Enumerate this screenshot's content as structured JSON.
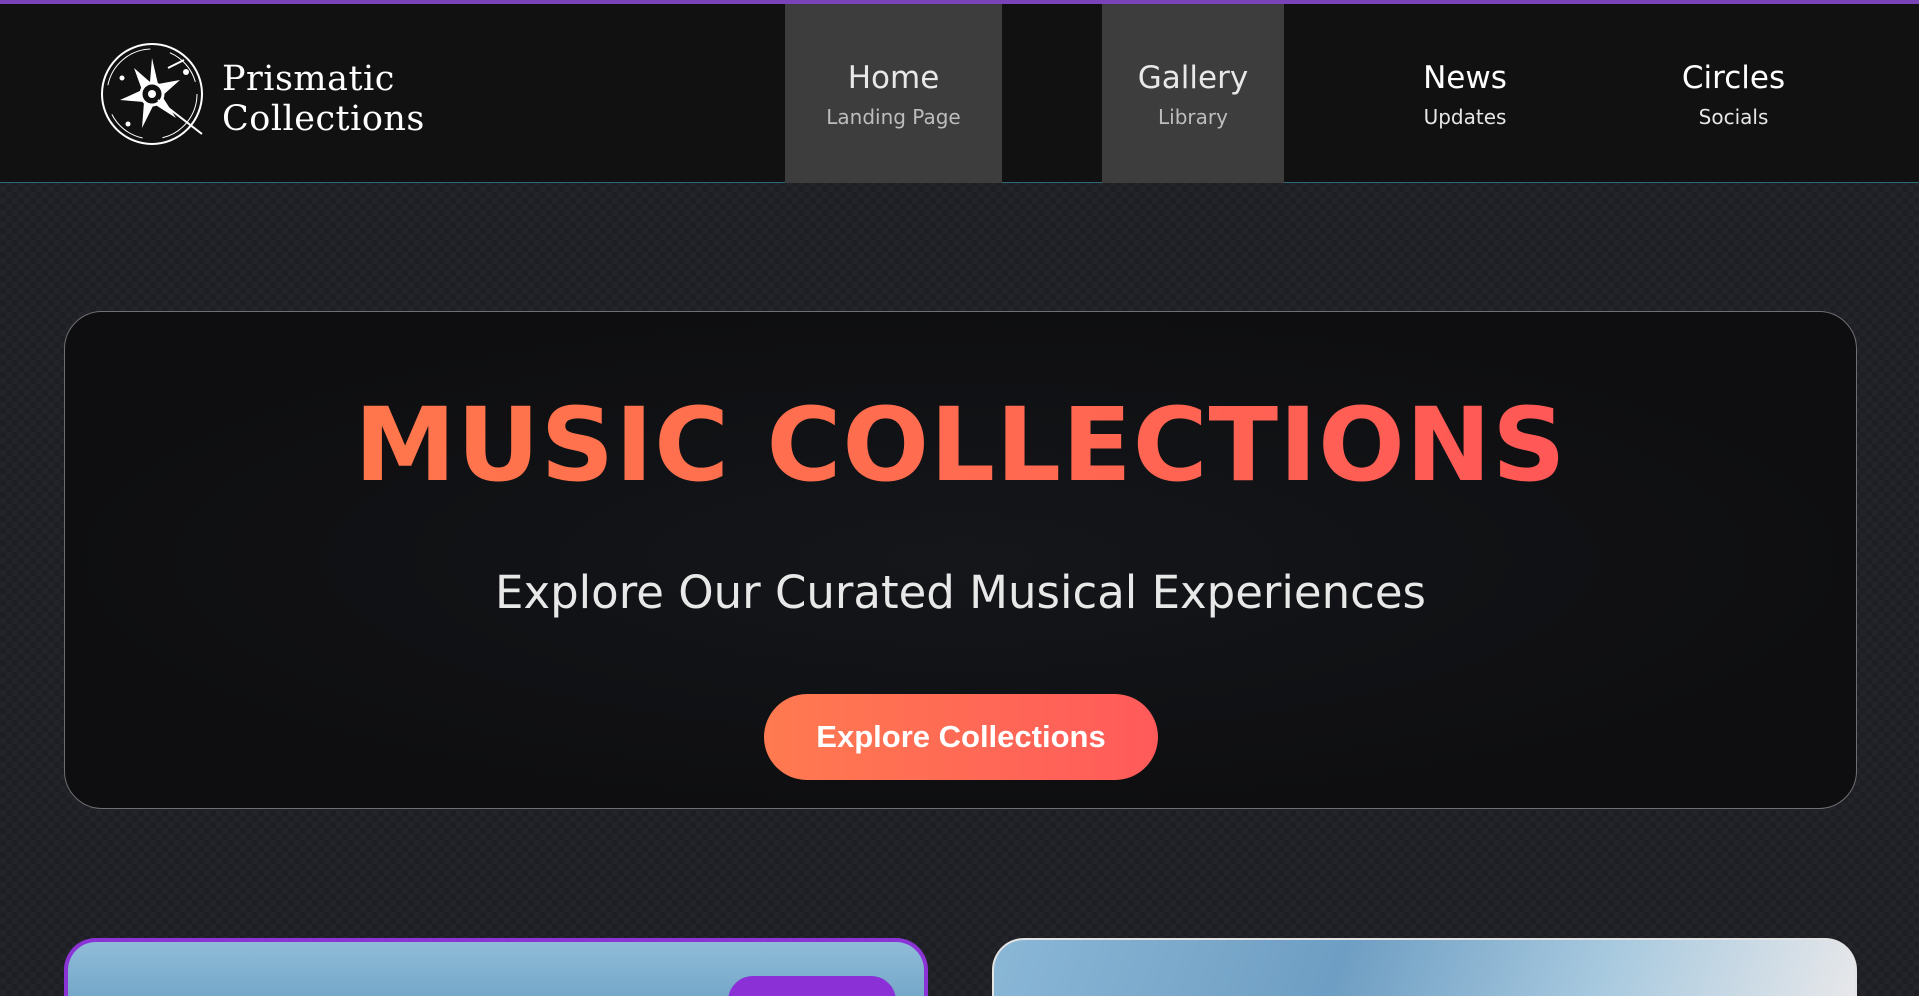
{
  "brand": {
    "line1": "Prismatic",
    "line2": "Collections",
    "icon": "compass-star-logo-icon"
  },
  "nav": {
    "items": [
      {
        "title": "Home",
        "subtitle": "Landing Page",
        "active": true
      },
      {
        "title": "Gallery",
        "subtitle": "Library",
        "active": true
      },
      {
        "title": "News",
        "subtitle": "Updates",
        "active": false
      },
      {
        "title": "Circles",
        "subtitle": "Socials",
        "active": false
      }
    ]
  },
  "hero": {
    "title": "MUSIC COLLECTIONS",
    "subtitle": "Explore Our Curated Musical Experiences",
    "button_label": "Explore Collections"
  },
  "colors": {
    "accent_top": "#7b43b8",
    "hero_gradient_start": "#ff7b49",
    "hero_gradient_end": "#ff4e5a",
    "card_border_highlight": "#8a34d6"
  }
}
